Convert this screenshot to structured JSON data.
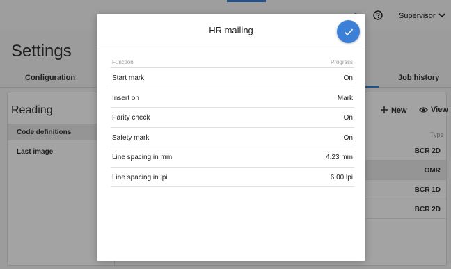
{
  "header": {
    "user": "Supervisor",
    "icons": [
      "help-icon",
      "chevron-down-icon"
    ]
  },
  "page": {
    "title": "Settings"
  },
  "tabs": {
    "configuration": "Configuration",
    "job_history": "Job history"
  },
  "panel": {
    "title": "Reading",
    "left_items": [
      "Code definitions",
      "Last image"
    ],
    "actions": {
      "new": "New",
      "view": "View"
    },
    "type_header": "Type",
    "types": [
      "BCR 2D",
      "OMR",
      "BCR 1D",
      "BCR 2D"
    ]
  },
  "modal": {
    "title": "HR mailing",
    "columns": {
      "function": "Function",
      "progress": "Progress"
    },
    "rows": [
      {
        "function": "Start mark",
        "value": "On"
      },
      {
        "function": "Insert on",
        "value": "Mark"
      },
      {
        "function": "Parity check",
        "value": "On"
      },
      {
        "function": "Safety mark",
        "value": "On"
      },
      {
        "function": "Line spacing in mm",
        "value": "4.23 mm"
      },
      {
        "function": "Line spacing in lpi",
        "value": "6.00 lpi"
      }
    ]
  },
  "colors": {
    "accent": "#3b7fd6",
    "overlay": "rgba(0,0,0,0.36)"
  }
}
